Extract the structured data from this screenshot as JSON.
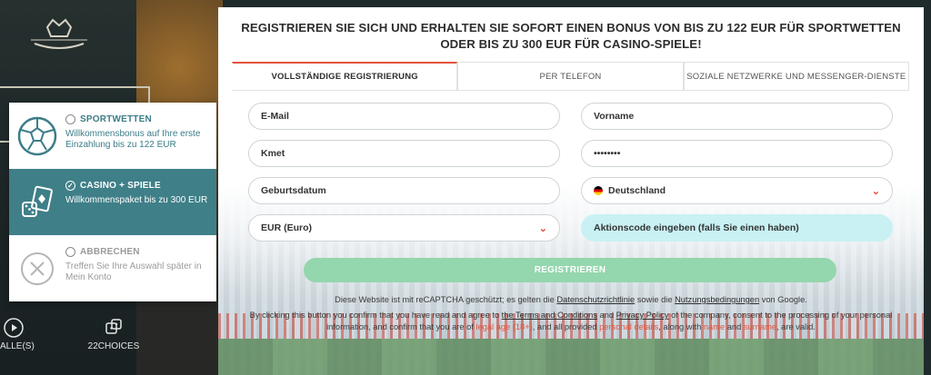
{
  "background": {
    "nav": [
      {
        "label": "ALLE(S)",
        "icon": "play-icon"
      },
      {
        "label": "22CHOICES",
        "icon": "dice-icon"
      }
    ]
  },
  "offers": [
    {
      "id": "sport",
      "title": "SPORTWETTEN",
      "desc": "Willkommensbonus auf Ihre erste Einzahlung bis zu 122 EUR",
      "selected": false,
      "icon": "football-icon"
    },
    {
      "id": "casino",
      "title": "CASINO + SPIELE",
      "desc": "Willkommenspaket bis zu 300 EUR",
      "selected": true,
      "icon": "casino-cards-icon"
    },
    {
      "id": "cancel",
      "title": "ABBRECHEN",
      "desc": "Treffen Sie Ihre Auswahl später in Mein Konto",
      "selected": false,
      "icon": "close-circle-icon"
    }
  ],
  "modal": {
    "title": "REGISTRIEREN SIE SICH UND ERHALTEN SIE SOFORT EINEN BONUS VON BIS ZU 122 EUR FÜR SPORTWETTEN ODER BIS ZU 300 EUR FÜR CASINO-SPIELE!",
    "tabs": [
      {
        "label": "VOLLSTÄNDIGE REGISTRIERUNG",
        "active": true
      },
      {
        "label": "PER TELEFON",
        "active": false
      },
      {
        "label": "SOZIALE NETZWERKE UND MESSENGER-DIENSTE",
        "active": false
      }
    ],
    "fields": {
      "email": "E-Mail",
      "firstname": "Vorname",
      "lastname": "Kmet",
      "password": "••••••••",
      "birthdate": "Geburtsdatum",
      "country": "Deutschland",
      "currency": "EUR (Euro)",
      "promo": "Aktionscode eingeben (falls Sie einen haben)"
    },
    "register_label": "REGISTRIEREN",
    "legal": {
      "line1_a": "Diese Website ist mit reCAPTCHA geschützt; es gelten die ",
      "line1_link1": "Datenschutzrichtlinie",
      "line1_b": " sowie die ",
      "line1_link2": "Nutzungsbedingungen",
      "line1_c": " von Google.",
      "line2_a": "By clicking this button you confirm that you have read and agree to ",
      "line2_link1": "the Terms and Conditions",
      "line2_b": " and ",
      "line2_link2": "Privacy Policy",
      "line2_c": " of the company, consent to the processing of your personal information, and confirm that you are of ",
      "line2_age": "legal age (18+)",
      "line2_d": ", and all provided ",
      "line2_details": "personal details",
      "line2_e": ", along with ",
      "line2_name": "name",
      "line2_f": " and ",
      "line2_surname": "surname",
      "line2_g": ", are valid."
    }
  },
  "colors": {
    "accent": "#e4533c",
    "teal": "#3f7f88",
    "register": "#94d6ad",
    "promo": "#c9f1f4"
  }
}
